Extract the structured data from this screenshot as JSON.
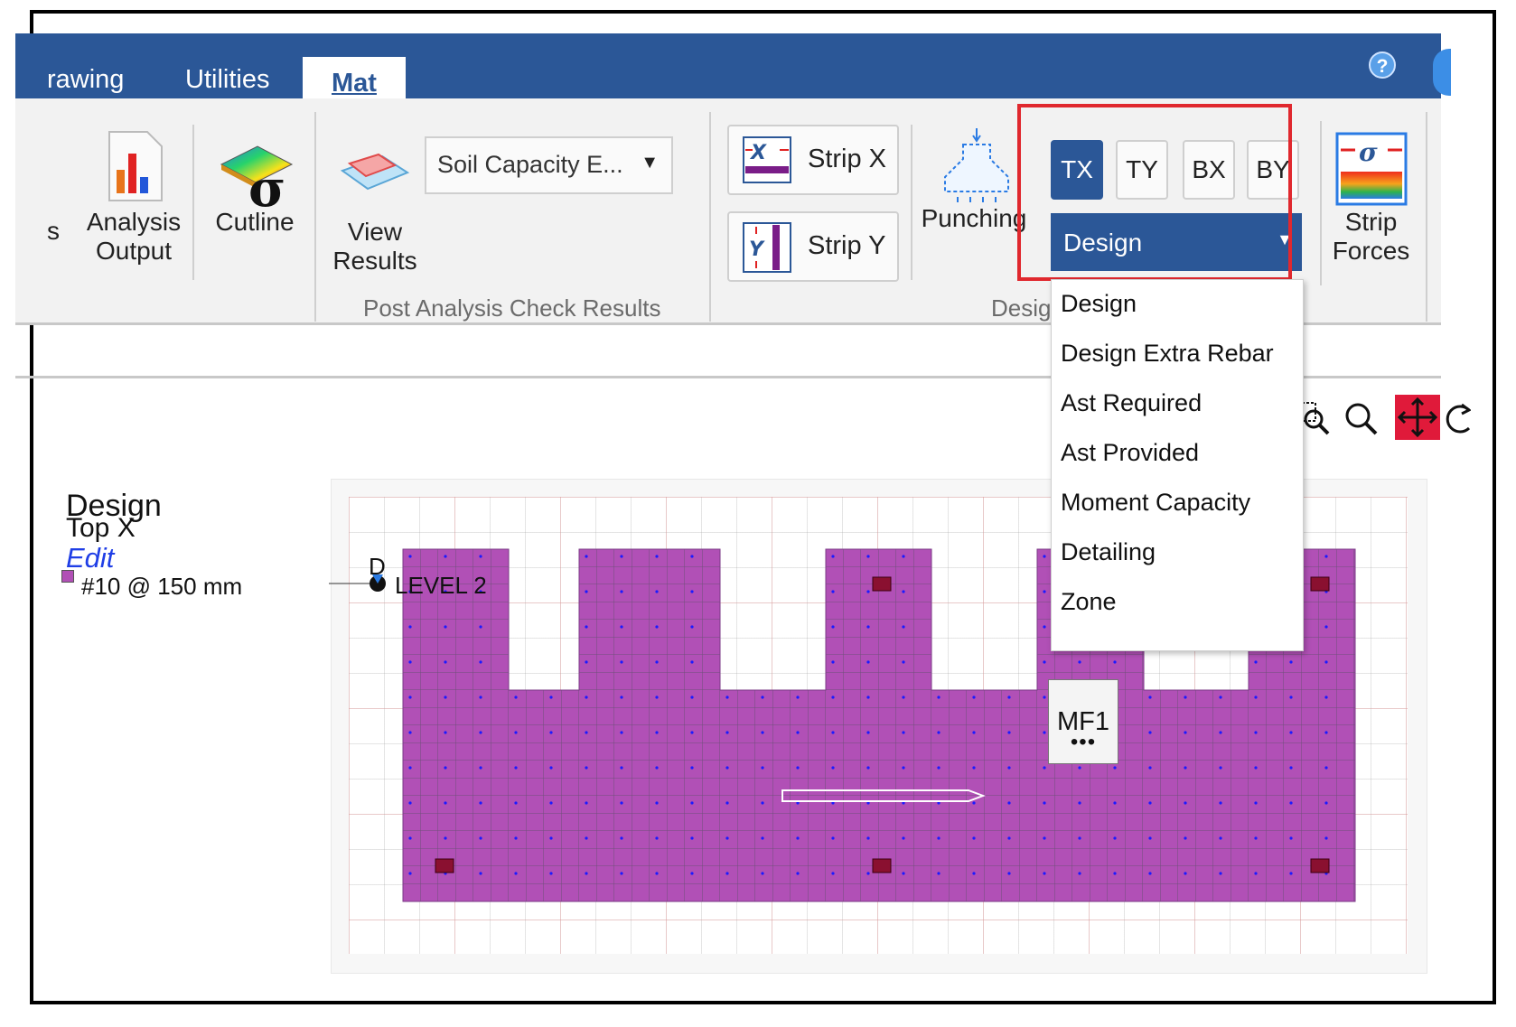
{
  "ribbon": {
    "tabs": [
      {
        "label": "rawing"
      },
      {
        "label": "Utilities"
      },
      {
        "label": "Mat"
      }
    ],
    "cut_left_label": "s",
    "analysis_output": {
      "line1": "Analysis",
      "line2": "Output"
    },
    "cutline": {
      "label": "Cutline"
    },
    "view_results": {
      "line1": "View",
      "line2": "Results"
    },
    "result_combo": {
      "value": "Soil Capacity E..."
    },
    "group_post_analysis": "Post Analysis Check Results",
    "strip_x": "Strip X",
    "strip_y": "Strip Y",
    "punching": "Punching",
    "group_design": "Desig",
    "toggles": [
      "TX",
      "TY",
      "BX",
      "BY"
    ],
    "design_select": {
      "value": "Design"
    },
    "strip_forces": {
      "line1": "Strip",
      "line2": "Forces"
    },
    "help": "?"
  },
  "dropdown": {
    "items": [
      "Design",
      "Design Extra Rebar",
      "Ast Required",
      "Ast Provided",
      "Moment Capacity",
      "Detailing",
      "Zone"
    ]
  },
  "legend": {
    "title": "Design",
    "subtitle": "Top X",
    "edit": "Edit",
    "rebar": "#10  @ 150 mm"
  },
  "canvas": {
    "d_label": "D",
    "level_label": "LEVEL 2",
    "mat_label": "MF1",
    "mat_dots": "•••"
  },
  "colors": {
    "ribbon_blue": "#2b5797",
    "mat_fill": "#b150b6",
    "highlight_red": "#e0282e",
    "pan_active": "#e01a3a"
  }
}
